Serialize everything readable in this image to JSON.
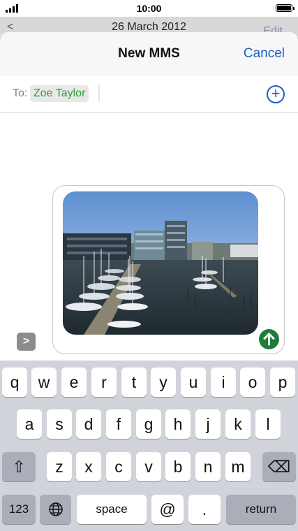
{
  "status": {
    "time": "10:00"
  },
  "behind": {
    "back": "<",
    "date": "26 March 2012",
    "edit": "Edit"
  },
  "nav": {
    "title": "New MMS",
    "cancel": "Cancel"
  },
  "recipient": {
    "label": "To:",
    "name": "Zoe Taylor"
  },
  "compose": {
    "attachment": "photo of marina with moored boats",
    "send_icon": "arrow-up-icon"
  },
  "keyboard": {
    "row1": [
      "q",
      "w",
      "e",
      "r",
      "t",
      "y",
      "u",
      "i",
      "o",
      "p"
    ],
    "row2": [
      "a",
      "s",
      "d",
      "f",
      "g",
      "h",
      "j",
      "k",
      "l"
    ],
    "row3": [
      "z",
      "x",
      "c",
      "v",
      "b",
      "n",
      "m"
    ],
    "shift": "⇧",
    "delete": "⌫",
    "numbers": "123",
    "space": "space",
    "at": "@",
    "dot": ".",
    "return": "return"
  },
  "colors": {
    "accent": "#1c5fc9",
    "recipient": "#2f9e3b",
    "send": "#1f7d3b"
  }
}
